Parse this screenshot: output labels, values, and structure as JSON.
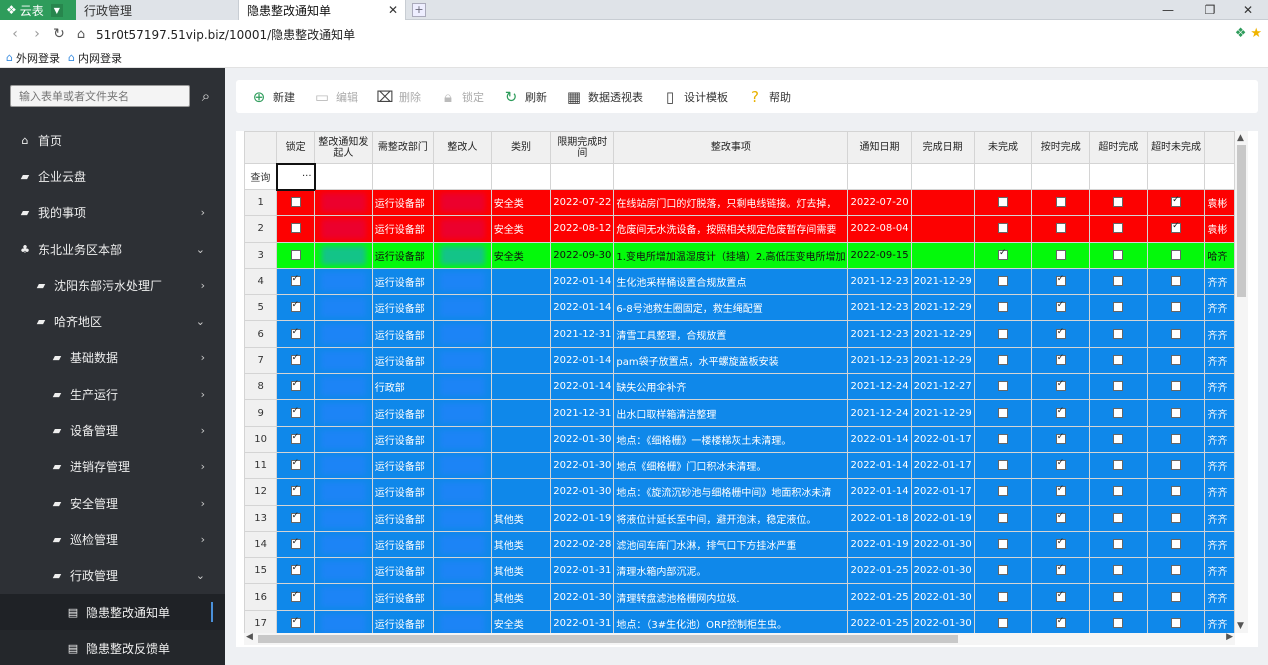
{
  "browser": {
    "app_name": "云表",
    "tabs": [
      {
        "label": "行政管理"
      },
      {
        "label": "隐患整改通知单"
      }
    ],
    "url": "51r0t57197.51vip.biz/10001/隐患整改通知单",
    "bookmarks": [
      {
        "label": "外网登录"
      },
      {
        "label": "内网登录"
      }
    ]
  },
  "sidebar": {
    "search_placeholder": "输入表单或者文件夹名",
    "items": [
      {
        "label": "首页"
      },
      {
        "label": "企业云盘"
      },
      {
        "label": "我的事项"
      },
      {
        "label": "东北业务区本部"
      },
      {
        "label": "沈阳东部污水处理厂"
      },
      {
        "label": "哈齐地区"
      },
      {
        "label": "基础数据"
      },
      {
        "label": "生产运行"
      },
      {
        "label": "设备管理"
      },
      {
        "label": "进销存管理"
      },
      {
        "label": "安全管理"
      },
      {
        "label": "巡检管理"
      },
      {
        "label": "行政管理"
      },
      {
        "label": "隐患整改通知单"
      },
      {
        "label": "隐患整改反馈单"
      }
    ]
  },
  "toolbar": {
    "buttons": [
      {
        "label": "新建"
      },
      {
        "label": "编辑"
      },
      {
        "label": "删除"
      },
      {
        "label": "锁定"
      },
      {
        "label": "刷新"
      },
      {
        "label": "数据透视表"
      },
      {
        "label": "设计模板"
      },
      {
        "label": "帮助"
      }
    ]
  },
  "table": {
    "headers": [
      "锁定",
      "整改通知发起人",
      "需整改部门",
      "整改人",
      "类别",
      "限期完成时间",
      "整改事项",
      "通知日期",
      "完成日期",
      "未完成",
      "按时完成",
      "超时完成",
      "超时未完成"
    ],
    "filter_label": "查询",
    "filter_dots": "···",
    "rows": [
      {
        "n": "1",
        "color": "red",
        "lock": false,
        "dept": "运行设备部",
        "cat": "安全类",
        "due": "2022-07-22",
        "item": "在线站房门口的灯脱落，只剩电线链接。灯去掉，",
        "notice": "2022-07-20",
        "done": "",
        "c1": false,
        "c2": false,
        "c3": false,
        "c4": true,
        "tail": "袁彬"
      },
      {
        "n": "2",
        "color": "red",
        "lock": false,
        "dept": "运行设备部",
        "cat": "安全类",
        "due": "2022-08-12",
        "item": "危废间无水洗设备，按照相关规定危废暂存间需要",
        "notice": "2022-08-04",
        "done": "",
        "c1": false,
        "c2": false,
        "c3": false,
        "c4": true,
        "tail": "袁彬"
      },
      {
        "n": "3",
        "color": "green",
        "lock": false,
        "dept": "运行设备部",
        "cat": "安全类",
        "due": "2022-09-30",
        "item": "1.变电所增加温湿度计（挂墙）2.高低压变电所增加",
        "notice": "2022-09-15",
        "done": "",
        "c1": true,
        "c2": false,
        "c3": false,
        "c4": false,
        "tail": "哈齐"
      },
      {
        "n": "4",
        "color": "blue",
        "lock": true,
        "dept": "运行设备部",
        "cat": "",
        "due": "2022-01-14",
        "item": "生化池采样桶设置合规放置点",
        "notice": "2021-12-23",
        "done": "2021-12-29",
        "c1": false,
        "c2": true,
        "c3": false,
        "c4": false,
        "tail": "齐齐"
      },
      {
        "n": "5",
        "color": "blue",
        "lock": true,
        "dept": "运行设备部",
        "cat": "",
        "due": "2022-01-14",
        "item": "6-8号池救生圈固定，救生绳配置",
        "notice": "2021-12-23",
        "done": "2021-12-29",
        "c1": false,
        "c2": true,
        "c3": false,
        "c4": false,
        "tail": "齐齐"
      },
      {
        "n": "6",
        "color": "blue",
        "lock": true,
        "dept": "运行设备部",
        "cat": "",
        "due": "2021-12-31",
        "item": "清雪工具整理，合规放置",
        "notice": "2021-12-23",
        "done": "2021-12-29",
        "c1": false,
        "c2": true,
        "c3": false,
        "c4": false,
        "tail": "齐齐"
      },
      {
        "n": "7",
        "color": "blue",
        "lock": true,
        "dept": "运行设备部",
        "cat": "",
        "due": "2022-01-14",
        "item": "pam袋子放置点，水平螺旋盖板安装",
        "notice": "2021-12-23",
        "done": "2021-12-29",
        "c1": false,
        "c2": true,
        "c3": false,
        "c4": false,
        "tail": "齐齐"
      },
      {
        "n": "8",
        "color": "blue",
        "lock": true,
        "dept": "行政部",
        "cat": "",
        "due": "2022-01-14",
        "item": "缺失公用伞补齐",
        "notice": "2021-12-24",
        "done": "2021-12-27",
        "c1": false,
        "c2": true,
        "c3": false,
        "c4": false,
        "tail": "齐齐"
      },
      {
        "n": "9",
        "color": "blue",
        "lock": true,
        "dept": "运行设备部",
        "cat": "",
        "due": "2021-12-31",
        "item": "出水口取样箱清洁整理",
        "notice": "2021-12-24",
        "done": "2021-12-29",
        "c1": false,
        "c2": true,
        "c3": false,
        "c4": false,
        "tail": "齐齐"
      },
      {
        "n": "10",
        "color": "blue",
        "lock": true,
        "dept": "运行设备部",
        "cat": "",
        "due": "2022-01-30",
        "item": "地点：《细格栅》一楼楼梯灰土未清理。",
        "notice": "2022-01-14",
        "done": "2022-01-17",
        "c1": false,
        "c2": true,
        "c3": false,
        "c4": false,
        "tail": "齐齐"
      },
      {
        "n": "11",
        "color": "blue",
        "lock": true,
        "dept": "运行设备部",
        "cat": "",
        "due": "2022-01-30",
        "item": "地点《细格栅》门口积冰未清理。",
        "notice": "2022-01-14",
        "done": "2022-01-17",
        "c1": false,
        "c2": true,
        "c3": false,
        "c4": false,
        "tail": "齐齐"
      },
      {
        "n": "12",
        "color": "blue",
        "lock": true,
        "dept": "运行设备部",
        "cat": "",
        "due": "2022-01-30",
        "item": "地点：《旋流沉砂池与细格栅中间》地面积冰未清",
        "notice": "2022-01-14",
        "done": "2022-01-17",
        "c1": false,
        "c2": true,
        "c3": false,
        "c4": false,
        "tail": "齐齐"
      },
      {
        "n": "13",
        "color": "blue",
        "lock": true,
        "dept": "运行设备部",
        "cat": "其他类",
        "due": "2022-01-19",
        "item": "将液位计延长至中间，避开泡沫，稳定液位。",
        "notice": "2022-01-18",
        "done": "2022-01-19",
        "c1": false,
        "c2": true,
        "c3": false,
        "c4": false,
        "tail": "齐齐"
      },
      {
        "n": "14",
        "color": "blue",
        "lock": true,
        "dept": "运行设备部",
        "cat": "其他类",
        "due": "2022-02-28",
        "item": "滤池间车库门水淋，排气口下方挂冰严重",
        "notice": "2022-01-19",
        "done": "2022-01-30",
        "c1": false,
        "c2": true,
        "c3": false,
        "c4": false,
        "tail": "齐齐"
      },
      {
        "n": "15",
        "color": "blue",
        "lock": true,
        "dept": "运行设备部",
        "cat": "其他类",
        "due": "2022-01-31",
        "item": "清理水箱内部沉泥。",
        "notice": "2022-01-25",
        "done": "2022-01-30",
        "c1": false,
        "c2": true,
        "c3": false,
        "c4": false,
        "tail": "齐齐"
      },
      {
        "n": "16",
        "color": "blue",
        "lock": true,
        "dept": "运行设备部",
        "cat": "其他类",
        "due": "2022-01-30",
        "item": "清理转盘滤池格栅网内垃圾.",
        "notice": "2022-01-25",
        "done": "2022-01-30",
        "c1": false,
        "c2": true,
        "c3": false,
        "c4": false,
        "tail": "齐齐"
      },
      {
        "n": "17",
        "color": "blue",
        "lock": true,
        "dept": "运行设备部",
        "cat": "安全类",
        "due": "2022-01-31",
        "item": "地点：（3#生化池）ORP控制柜生虫。",
        "notice": "2022-01-25",
        "done": "2022-01-30",
        "c1": false,
        "c2": true,
        "c3": false,
        "c4": false,
        "tail": "齐齐"
      }
    ]
  }
}
